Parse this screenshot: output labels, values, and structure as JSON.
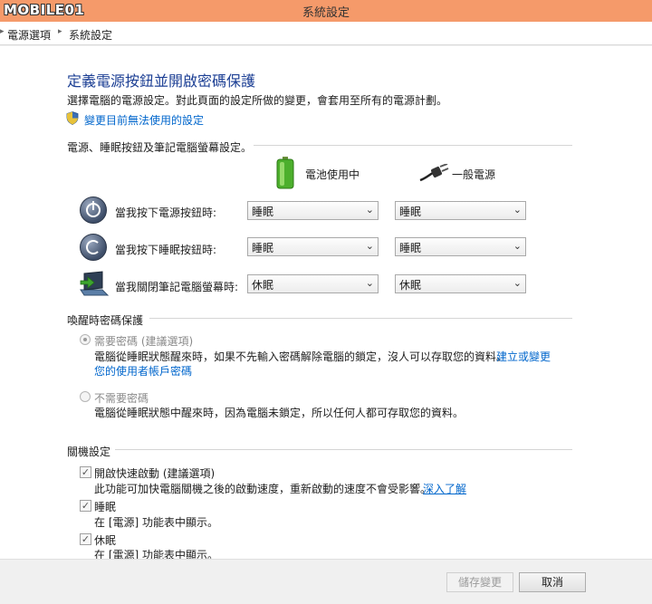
{
  "window": {
    "title": "系統設定",
    "watermark": "MOBILE01"
  },
  "breadcrumb": {
    "items": [
      "電源選項",
      "系統設定"
    ]
  },
  "page": {
    "heading": "定義電源按鈕並開啟密碼保護",
    "description": "選擇電腦的電源設定。對此頁面的設定所做的變更，會套用至所有的電源計劃。",
    "unavailable_link": "變更目前無法使用的設定"
  },
  "power_buttons": {
    "group_label": "電源、睡眠按鈕及筆記電腦螢幕設定。",
    "col_battery": "電池使用中",
    "col_plugged": "一般電源",
    "rows": [
      {
        "label": "當我按下電源按鈕時:",
        "battery": "睡眠",
        "plugged": "睡眠"
      },
      {
        "label": "當我按下睡眠按鈕時:",
        "battery": "睡眠",
        "plugged": "睡眠"
      },
      {
        "label": "當我關閉筆記電腦螢幕時:",
        "battery": "休眠",
        "plugged": "休眠"
      }
    ]
  },
  "wake_password": {
    "group_label": "喚醒時密碼保護",
    "require": {
      "label": "需要密碼 (建議選項)",
      "desc1": "電腦從睡眠狀態醒來時，如果不先輸入密碼解除電腦的鎖定，沒人可以存取您的資料。",
      "link_part1": "建立或變更",
      "link_part2": "您的使用者帳戶密碼",
      "selected": true
    },
    "not_require": {
      "label": "不需要密碼",
      "desc": "電腦從睡眠狀態中醒來時，因為電腦未鎖定，所以任何人都可存取您的資料。",
      "selected": false
    }
  },
  "shutdown": {
    "group_label": "關機設定",
    "items": [
      {
        "label": "開啟快速啟動 (建議選項)",
        "desc": "此功能可加快電腦關機之後的啟動速度，重新啟動的速度不會受影響。",
        "link": "深入了解",
        "checked": true
      },
      {
        "label": "睡眠",
        "desc": "在 [電源] 功能表中顯示。",
        "checked": true
      },
      {
        "label": "休眠",
        "desc": "在 [電源] 功能表中顯示。",
        "checked": true
      }
    ]
  },
  "footer": {
    "save_label": "儲存變更",
    "cancel_label": "取消"
  },
  "colors": {
    "titlebar": "#f59a6a",
    "heading": "#1c3f94",
    "link": "#0066cc"
  }
}
